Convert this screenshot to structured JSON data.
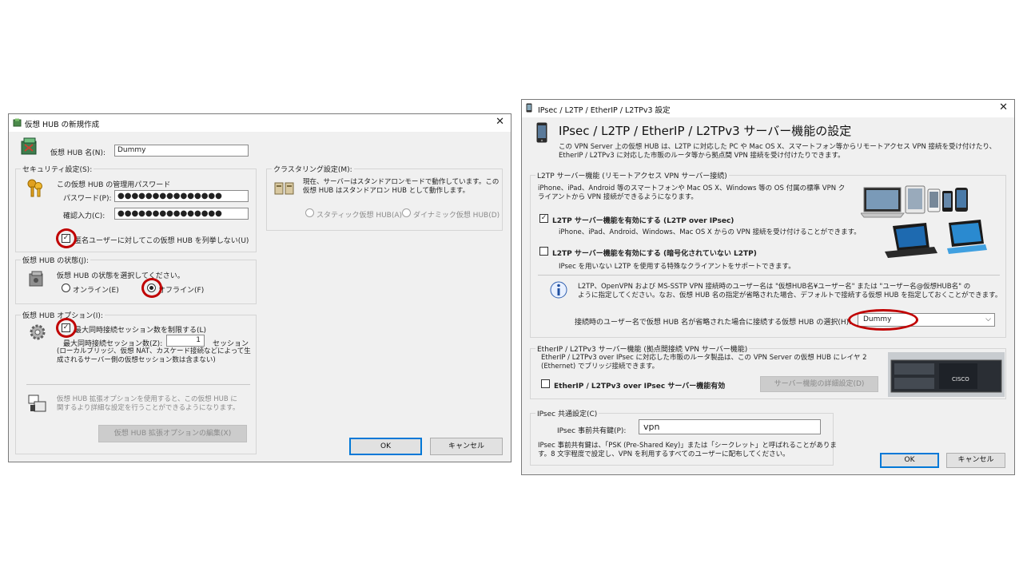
{
  "dialog1": {
    "title": "仮想 HUB の新規作成",
    "hub_name_label": "仮想 HUB 名(N):",
    "hub_name_value": "Dummy",
    "security": {
      "legend": "セキュリティ設定(S):",
      "admin_password_caption": "この仮想 HUB の管理用パスワード",
      "password_label": "パスワード(P):",
      "password_value": "●●●●●●●●●●●●●●●",
      "confirm_label": "確認入力(C):",
      "confirm_value": "●●●●●●●●●●●●●●●",
      "anon_enum_label": "匿名ユーザーに対してこの仮想 HUB を列挙しない(U)",
      "anon_enum_checked": true
    },
    "clustering": {
      "legend": "クラスタリング設定(M):",
      "description": [
        "現在、サーバーはスタンドアロンモードで動作しています。この",
        "仮想 HUB はスタンドアロン HUB として動作します。"
      ],
      "static_label": "スタティック仮想 HUB(A)",
      "dynamic_label": "ダイナミック仮想 HUB(D)"
    },
    "state": {
      "legend": "仮想 HUB の状態(J):",
      "caption": "仮想 HUB の状態を選択してください。",
      "online_label": "オンライン(E)",
      "offline_label": "オフライン(F)",
      "selected": "offline"
    },
    "options": {
      "legend": "仮想 HUB オプション(I):",
      "limit_sessions_label": "最大同時接続セッション数を制限する(L)",
      "limit_sessions_checked": true,
      "max_sessions_label": "最大同時接続セッション数(Z):",
      "max_sessions_value": "1",
      "session_unit": "セッション",
      "note": [
        "(ローカルブリッジ、仮想 NAT、カスケード接続などによって生",
        "成されるサーバー側の仮想セッション数は含まない)"
      ]
    },
    "extended": {
      "description": [
        "仮想 HUB 拡張オプションを使用すると、この仮想 HUB に",
        "関するより詳細な設定を行うことができるようになります。"
      ],
      "edit_button": "仮想 HUB 拡張オプションの編集(X)"
    },
    "ok": "OK",
    "cancel": "キャンセル",
    "close": "✕"
  },
  "dialog2": {
    "title": "IPsec / L2TP / EtherIP / L2TPv3 設定",
    "heading": "IPsec / L2TP / EtherIP / L2TPv3 サーバー機能の設定",
    "intro": [
      "この VPN Server 上の仮想 HUB は、L2TP に対応した PC や Mac OS X、スマートフォン等からリモートアクセス VPN 接続を受け付けたり、",
      "EtherIP / L2TPv3 に対応した市販のルータ等から拠点間 VPN 接続を受け付けたりできます。"
    ],
    "l2tp": {
      "legend": "L2TP サーバー機能 (リモートアクセス VPN サーバー接続)",
      "description": [
        "iPhone、iPad、Android 等のスマートフォンや Mac OS X、Windows 等の OS 付属の標準 VPN ク",
        "ライアントから VPN 接続ができるようになります。"
      ],
      "l2tp_ipsec_label": "L2TP サーバー機能を有効にする (L2TP over IPsec)",
      "l2tp_ipsec_checked": true,
      "l2tp_ipsec_note": "iPhone、iPad、Android、Windows、Mac OS X からの VPN 接続を受け付けることができます。",
      "raw_l2tp_label": "L2TP サーバー機能を有効にする (暗号化されていない L2TP)",
      "raw_l2tp_checked": false,
      "raw_l2tp_note": "IPsec を用いない L2TP を使用する特殊なクライアントをサポートできます。",
      "info": [
        "L2TP、OpenVPN および MS-SSTP VPN 接続時のユーザー名は \"仮想HUB名¥ユーザー名\" または \"ユーザー名@仮想HUB名\" の",
        "ように指定してください。なお、仮想 HUB 名の指定が省略された場合、デフォルトで接続する仮想 HUB を指定しておくことができます。"
      ],
      "default_hub_label": "接続時のユーザー名で仮想 HUB 名が省略された場合に接続する仮想 HUB の選択(H):",
      "default_hub_value": "Dummy"
    },
    "etherip": {
      "legend": "EtherIP / L2TPv3 サーバー機能 (拠点間接続 VPN サーバー機能)",
      "description": [
        "EtherIP / L2TPv3 over IPsec に対応した市販のルータ製品は、この VPN Server の仮想 HUB にレイヤ 2",
        "(Ethernet) でブリッジ接続できます。"
      ],
      "enable_label": "EtherIP / L2TPv3 over IPsec サーバー機能有効",
      "enable_checked": false,
      "detail_button": "サーバー機能の詳細設定(D)",
      "router_brand": "CISCO"
    },
    "ipsec": {
      "legend": "IPsec 共通設定(C)",
      "psk_label": "IPsec 事前共有鍵(P):",
      "psk_value": "vpn",
      "note": [
        "IPsec 事前共有鍵は、「PSK (Pre-Shared Key)」または「シークレット」と呼ばれることがありま",
        "す。8 文字程度で設定し、VPN を利用するすべてのユーザーに配布してください。"
      ]
    },
    "ok": "OK",
    "cancel": "キャンセル",
    "close": "✕"
  },
  "colors": {
    "highlight": "#c00000",
    "dialog_bg": "#f0f0f0",
    "default_button_border": "#0078d7"
  }
}
